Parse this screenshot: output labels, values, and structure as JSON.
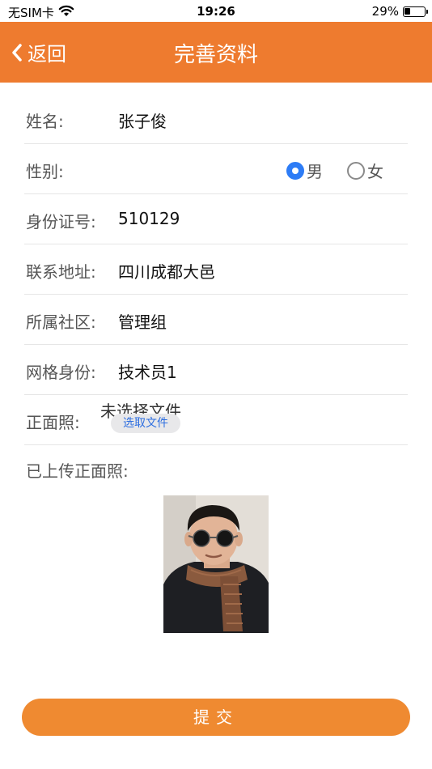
{
  "status_bar": {
    "carrier": "无SIM卡",
    "time": "19:26",
    "battery_percent": "29%",
    "battery_level": 0.29,
    "wifi_icon": "wifi-icon"
  },
  "header": {
    "back_label": "返回",
    "title": "完善资料",
    "color": "#ee7b2f"
  },
  "form": {
    "name": {
      "label": "姓名:",
      "value": "张子俊"
    },
    "gender": {
      "label": "性别:",
      "options": [
        {
          "label": "男",
          "checked": true
        },
        {
          "label": "女",
          "checked": false
        }
      ]
    },
    "id_number": {
      "label": "身份证号:",
      "value": "510129"
    },
    "address": {
      "label": "联系地址:",
      "value": "四川成都大邑"
    },
    "community": {
      "label": "所属社区:",
      "value": "管理组"
    },
    "grid_role": {
      "label": "网格身份:",
      "value": "技术员1"
    },
    "front_photo": {
      "label": "正面照:",
      "file_status": "未选择文件",
      "choose_label": "选取文件"
    }
  },
  "uploaded": {
    "label": "已上传正面照:"
  },
  "submit": {
    "label": "提交",
    "color": "#ef8a31"
  },
  "accent": "#2d7cf6"
}
